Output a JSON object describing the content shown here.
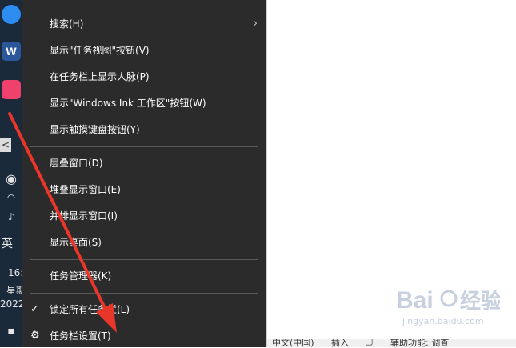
{
  "taskbar": {
    "app_letter": "W",
    "input_mode": "英",
    "clock_time": "16:",
    "clock_day": "星期",
    "clock_date": "2022/",
    "collapse_symbol": "<"
  },
  "context_menu": {
    "items": [
      {
        "label": "搜索(H)",
        "has_submenu": true
      },
      {
        "label": "显示\"任务视图\"按钮(V)"
      },
      {
        "label": "在任务栏上显示人脉(P)"
      },
      {
        "label": "显示\"Windows Ink 工作区\"按钮(W)"
      },
      {
        "label": "显示触摸键盘按钮(Y)"
      },
      {
        "label": "层叠窗口(D)"
      },
      {
        "label": "堆叠显示窗口(E)"
      },
      {
        "label": "并排显示窗口(I)"
      },
      {
        "label": "显示桌面(S)"
      },
      {
        "label": "任务管理器(K)"
      },
      {
        "label": "锁定所有任务栏(L)",
        "checked": true
      },
      {
        "label": "任务栏设置(T)",
        "icon": "gear-icon"
      }
    ]
  },
  "status_bar": {
    "lang": "中文(中国)",
    "insert": "插入",
    "accessibility": "辅助功能: 调查"
  },
  "watermark": {
    "text": "Bai",
    "text2": "经验",
    "sub": "jingyan.baidu.com"
  },
  "colors": {
    "menu_bg": "#2b2b2b",
    "taskbar_bg": "#1b2a3a",
    "arrow": "#e8362a"
  }
}
